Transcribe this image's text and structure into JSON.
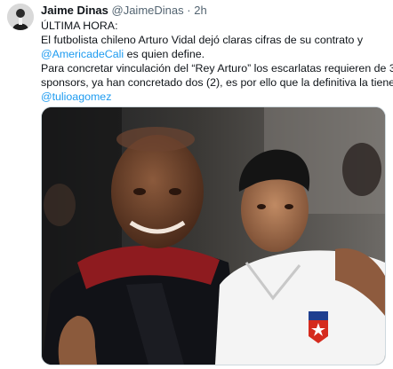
{
  "tweet": {
    "author": {
      "name": "Jaime Dinas",
      "handle": "@JaimeDinas",
      "separator": "·",
      "time": "2h"
    },
    "lines": {
      "l1": "ÚLTIMA HORA:",
      "l2": "El futbolista chileno Arturo Vidal dejó claras cifras de su contrato y",
      "l3_mention": "@AmericadeCali",
      "l3_rest": " es quien define.",
      "l4": "Para concretar vinculación del “Rey Arturo” los escarlatas requieren de 3",
      "l5": "sponsors, ya han concretado dos (2), es por ello que la definitiva la tiene",
      "l6_mention": "@tulioagomez"
    },
    "colors": {
      "link": "#1d9bf0",
      "text": "#0f1419",
      "secondary": "#536471"
    },
    "media": {
      "description_icons": [
        "photo"
      ]
    }
  }
}
